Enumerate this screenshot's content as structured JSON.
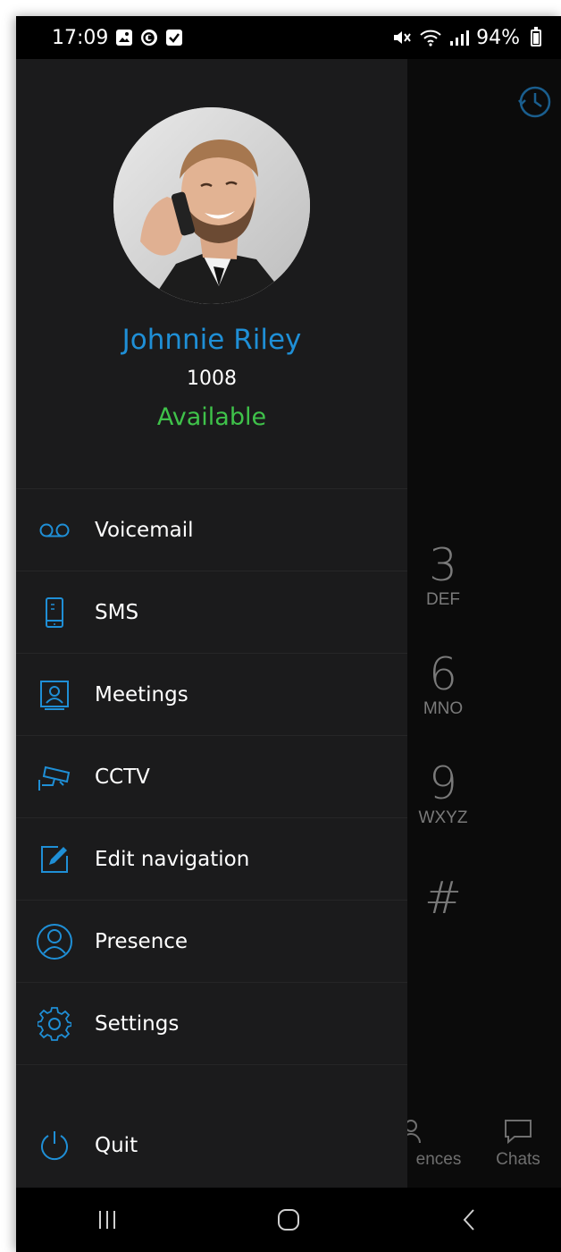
{
  "status_bar": {
    "time": "17:09",
    "battery_percent": "94%",
    "icons_left": [
      "gallery-icon",
      "g-app-icon",
      "checkbox-icon"
    ],
    "icons_right": [
      "mute-icon",
      "wifi-icon",
      "signal-icon",
      "battery-icon"
    ]
  },
  "profile": {
    "name": "Johnnie Riley",
    "extension": "1008",
    "status": "Available",
    "status_color": "#3fc24a",
    "name_color": "#1f8fd6"
  },
  "menu": {
    "items": [
      {
        "label": "Voicemail",
        "icon": "voicemail-icon"
      },
      {
        "label": "SMS",
        "icon": "phone-sms-icon"
      },
      {
        "label": "Meetings",
        "icon": "meeting-icon"
      },
      {
        "label": "CCTV",
        "icon": "cctv-camera-icon"
      },
      {
        "label": "Edit navigation",
        "icon": "edit-icon"
      },
      {
        "label": "Presence",
        "icon": "person-icon"
      },
      {
        "label": "Settings",
        "icon": "gear-icon"
      }
    ],
    "quit_label": "Quit"
  },
  "dialer": {
    "keys": [
      {
        "digit": "3",
        "letters": "DEF"
      },
      {
        "digit": "6",
        "letters": "MNO"
      },
      {
        "digit": "9",
        "letters": "WXYZ"
      },
      {
        "digit": "#",
        "letters": ""
      }
    ],
    "tabs": [
      "ences",
      "Chats"
    ]
  },
  "accent_color": "#1f8fd6"
}
